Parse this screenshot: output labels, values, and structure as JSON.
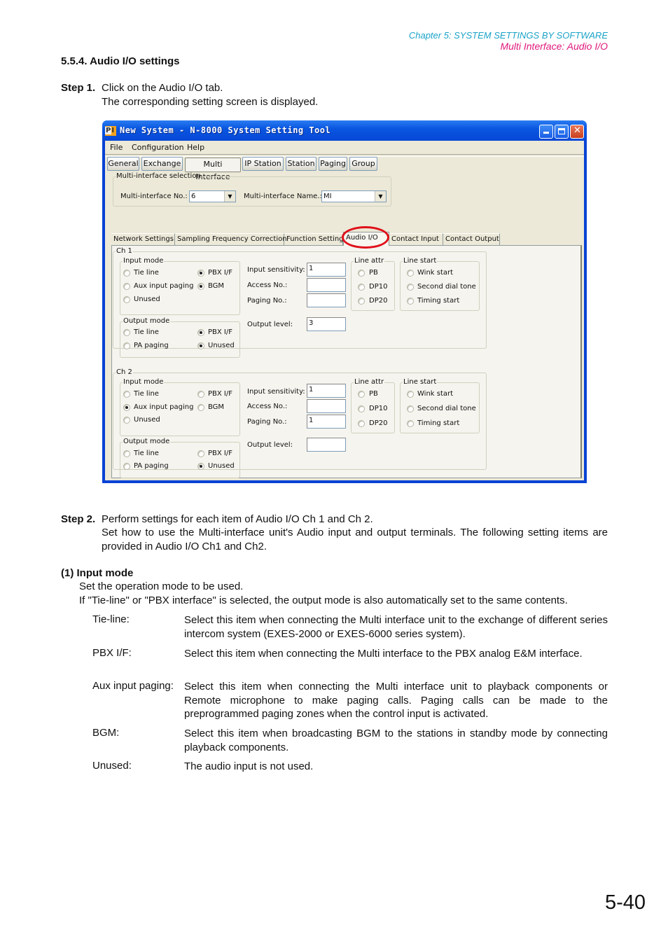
{
  "header": {
    "chapter": "Chapter 5:  SYSTEM SETTINGS BY SOFTWARE",
    "section": "Multi Interface: Audio I/O"
  },
  "section_title": "5.5.4. Audio I/O settings",
  "step1": {
    "label": "Step 1.",
    "line1": "Click on the Audio I/O tab.",
    "line2": "The corresponding setting screen is displayed."
  },
  "window": {
    "title": "New System - N-8000 System Setting Tool",
    "icon": "app-logo-icon",
    "controls": [
      "minimize",
      "maximize",
      "close"
    ],
    "menu": [
      "File",
      "Configuration",
      "Help"
    ],
    "top_tabs": [
      "General",
      "Exchange",
      "Multi Interface",
      "IP Station",
      "Station",
      "Paging",
      "Group"
    ],
    "active_top_tab": "Multi Interface",
    "mi_selection": {
      "legend": "Multi-interface selection",
      "no_label": "Multi-interface No.:",
      "no_value": "6",
      "name_label": "Multi-interface Name.:",
      "name_value": "MI"
    },
    "sub_tabs": [
      "Network Settings",
      "Sampling Frequency Correction",
      "Function Settings",
      "Audio I/O",
      "Contact Input",
      "Contact Output"
    ],
    "active_sub_tab": "Audio I/O",
    "channels": [
      {
        "legend": "Ch 1",
        "input_mode": {
          "legend": "Input mode",
          "options": [
            "Tie line",
            "PBX I/F",
            "Aux input paging",
            "BGM",
            "Unused"
          ],
          "selected": [
            "PBX I/F",
            "BGM"
          ]
        },
        "output_mode": {
          "legend": "Output mode",
          "options": [
            "Tie line",
            "PBX I/F",
            "PA paging",
            "Unused"
          ],
          "selected": [
            "PBX I/F",
            "Unused"
          ]
        },
        "input_sensitivity": {
          "label": "Input sensitivity:",
          "value": "1"
        },
        "access_no": {
          "label": "Access No.:",
          "value": ""
        },
        "paging_no": {
          "label": "Paging No.:",
          "value": ""
        },
        "output_level": {
          "label": "Output level:",
          "value": "3"
        },
        "line_attr": {
          "legend": "Line attr",
          "options": [
            "PB",
            "DP10",
            "DP20"
          ]
        },
        "line_start": {
          "legend": "Line start",
          "options": [
            "Wink start",
            "Second dial tone",
            "Timing start"
          ]
        }
      },
      {
        "legend": "Ch 2",
        "input_mode": {
          "legend": "Input mode",
          "options": [
            "Tie line",
            "PBX I/F",
            "Aux input paging",
            "BGM",
            "Unused"
          ],
          "selected": [
            "Aux input paging"
          ]
        },
        "output_mode": {
          "legend": "Output mode",
          "options": [
            "Tie line",
            "PBX I/F",
            "PA paging",
            "Unused"
          ],
          "selected": [
            "Unused"
          ]
        },
        "input_sensitivity": {
          "label": "Input sensitivity:",
          "value": "1"
        },
        "access_no": {
          "label": "Access No.:",
          "value": ""
        },
        "paging_no": {
          "label": "Paging No.:",
          "value": "1"
        },
        "output_level": {
          "label": "Output level:",
          "value": ""
        },
        "line_attr": {
          "legend": "Line attr",
          "options": [
            "PB",
            "DP10",
            "DP20"
          ]
        },
        "line_start": {
          "legend": "Line start",
          "options": [
            "Wink start",
            "Second dial tone",
            "Timing start"
          ]
        }
      }
    ],
    "highlight_color": "#e0101a"
  },
  "step2": {
    "label": "Step 2.",
    "line1": "Perform settings for each item of Audio I/O Ch 1 and Ch 2.",
    "line2": "Set how to use the Multi-interface unit's Audio input and output terminals. The following setting items are provided in Audio I/O Ch1 and Ch2."
  },
  "input_mode_section": {
    "title": "(1)  Input mode",
    "line1": "Set the operation mode to be used.",
    "line2": "If \"Tie-line\" or \"PBX interface\" is selected, the output mode is also automatically set to the same contents.",
    "items": [
      {
        "term": "Tie-line:",
        "desc": "Select this item when connecting the Multi interface unit to the exchange of different series intercom system (EXES-2000 or EXES-6000 series system)."
      },
      {
        "term": "PBX I/F:",
        "desc": "Select this item when connecting the Multi interface to the PBX analog E&M interface."
      },
      {
        "term": "Aux input paging:",
        "desc": "Select this item when connecting the Multi interface unit to playback components or Remote microphone to make paging calls. Paging calls can be made to the preprogrammed paging zones when the control input is activated."
      },
      {
        "term": "BGM:",
        "desc": "Select this item when broadcasting BGM to the stations in standby mode by connecting playback components."
      },
      {
        "term": "Unused:",
        "desc": "The audio input is not used."
      }
    ]
  },
  "page_number": "5-40",
  "colors": {
    "chapter_header": "#1aa3c8",
    "section_header": "#e0187c",
    "window_frame": "#0842d4",
    "window_face": "#ece9d8"
  }
}
